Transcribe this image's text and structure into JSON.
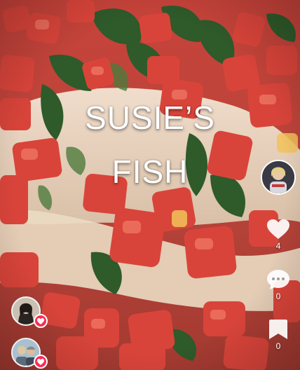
{
  "overlay": {
    "line1": "SUSIE’S",
    "line2": "FISH"
  },
  "actions": {
    "like_count": "4",
    "comment_count": "0",
    "save_count": "0"
  },
  "icons": {
    "like": "heart-icon",
    "comment": "comment-bubble-icon",
    "save": "bookmark-icon",
    "badge": "heart-badge-icon"
  },
  "colors": {
    "badge": "#fe2c55",
    "icon": "#ffffff",
    "tomato": "#d9443a",
    "basil": "#2f5a2a",
    "fish": "#efe3cf"
  }
}
